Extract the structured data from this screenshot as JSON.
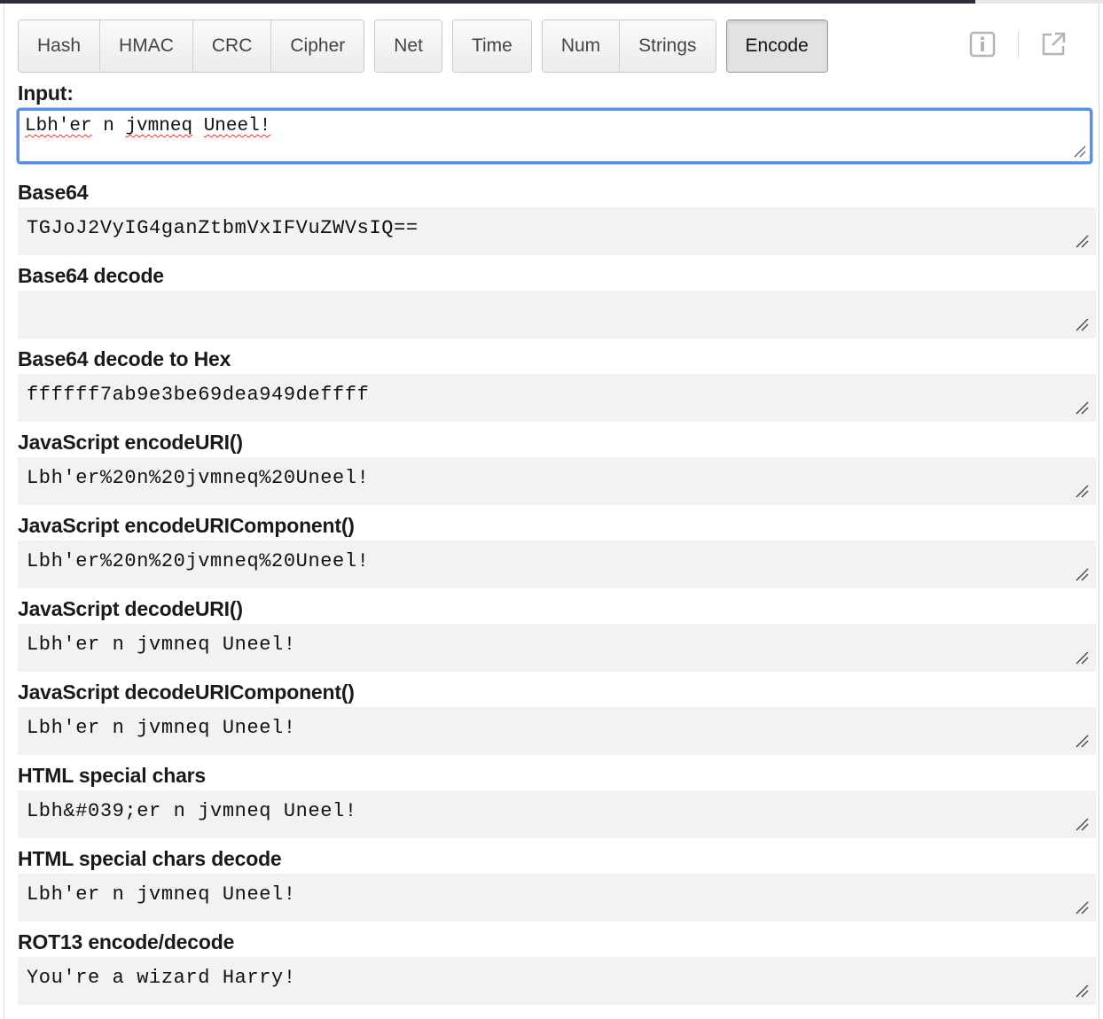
{
  "toolbar": {
    "groups": [
      [
        "Hash",
        "HMAC",
        "CRC",
        "Cipher"
      ],
      [
        "Net"
      ],
      [
        "Time"
      ],
      [
        "Num",
        "Strings"
      ],
      [
        "Encode"
      ]
    ],
    "active": "Encode"
  },
  "icons": {
    "info": "info-icon",
    "popout": "external-link-icon"
  },
  "input": {
    "label": "Input:",
    "value_words": [
      "Lbh'er",
      "n",
      "jvmneq",
      "Uneel!"
    ]
  },
  "fields": [
    {
      "label": "Base64",
      "value": "TGJoJ2VyIG4ganZtbmVxIFVuZWVsIQ=="
    },
    {
      "label": "Base64 decode",
      "value": ""
    },
    {
      "label": "Base64 decode to Hex",
      "value": "ffffff7ab9e3be69dea949deffff"
    },
    {
      "label": "JavaScript encodeURI()",
      "value": "Lbh'er%20n%20jvmneq%20Uneel!"
    },
    {
      "label": "JavaScript encodeURIComponent()",
      "value": "Lbh'er%20n%20jvmneq%20Uneel!"
    },
    {
      "label": "JavaScript decodeURI()",
      "value": "Lbh'er n jvmneq Uneel!"
    },
    {
      "label": "JavaScript decodeURIComponent()",
      "value": "Lbh'er n jvmneq Uneel!"
    },
    {
      "label": "HTML special chars",
      "value": "Lbh&#039;er n jvmneq Uneel!"
    },
    {
      "label": "HTML special chars decode",
      "value": "Lbh'er n jvmneq Uneel!"
    },
    {
      "label": "ROT13 encode/decode",
      "value": "You're a wizard Harry!"
    }
  ]
}
